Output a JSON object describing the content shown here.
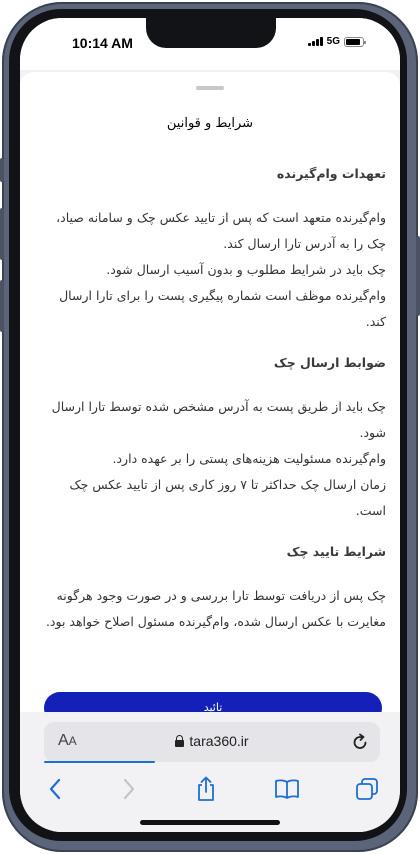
{
  "status_bar": {
    "time": "10:14 AM",
    "network": "5G",
    "battery_level": 0.9
  },
  "sheet": {
    "title": "شرایط و قوانین",
    "sections": [
      {
        "heading": "تعهدات وام‌گیرنده",
        "body": "وام‌گیرنده متعهد است که پس از تایید عکس چک و سامانه صیاد، چک را به آدرس تارا ارسال کند.\nچک باید در شرایط مطلوب و بدون آسیب ارسال شود.\nوام‌گیرنده موظف است شماره پیگیری پست را برای تارا ارسال کند."
      },
      {
        "heading": "ضوابط ارسال چک",
        "body": "چک باید از طریق پست به آدرس مشخص شده توسط تارا ارسال شود.\nوام‌گیرنده مسئولیت هزینه‌های پستی را بر عهده دارد.\nزمان ارسال چک حداکثر تا ۷ روز کاری پس از تایید عکس چک است."
      },
      {
        "heading": "شرایط تایید چک",
        "body": "چک پس از دریافت توسط تارا بررسی و در صورت وجود هرگونه مغایرت با عکس ارسال شده، وام‌گیرنده مسئول اصلاح خواهد بود."
      }
    ],
    "confirm_label": "تائید"
  },
  "browser": {
    "aa_large": "A",
    "aa_small": "A",
    "url": "tara360.ir",
    "load_progress": 0.33,
    "accent_color": "#1e6ed8"
  },
  "icons": {
    "back": "chevron-left-icon",
    "forward": "chevron-right-icon",
    "share": "share-icon",
    "bookmarks": "book-icon",
    "tabs": "tabs-icon",
    "lock": "lock-icon",
    "reload": "reload-icon"
  },
  "colors": {
    "primary_button": "#1321b8",
    "ios_blue": "#1e6ed8"
  }
}
